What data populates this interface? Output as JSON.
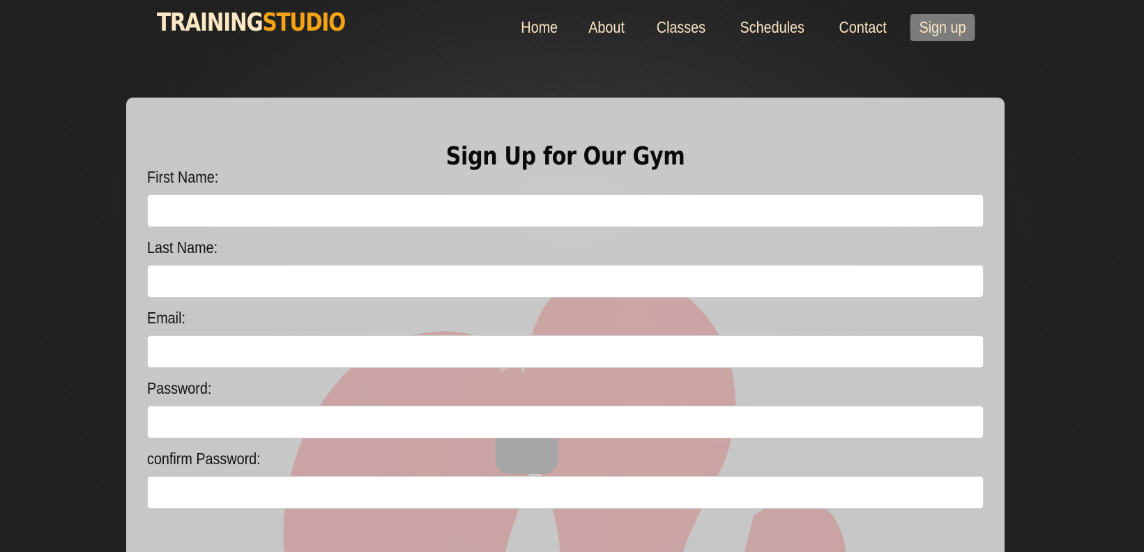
{
  "brand": {
    "primary": "TRAINING",
    "accent": "STUDIO",
    "primary_color": "#fbe7c4",
    "accent_color": "#f5a215"
  },
  "nav": {
    "items": [
      {
        "label": "Home",
        "active": false
      },
      {
        "label": "About",
        "active": false
      },
      {
        "label": "Classes",
        "active": false
      },
      {
        "label": "Schedules",
        "active": false
      },
      {
        "label": "Contact",
        "active": false
      },
      {
        "label": "Sign up",
        "active": true
      }
    ]
  },
  "form": {
    "title": "Sign Up for Our Gym",
    "fields": [
      {
        "label": "First Name:",
        "value": "",
        "placeholder": ""
      },
      {
        "label": "Last Name:",
        "value": "",
        "placeholder": ""
      },
      {
        "label": "Email:",
        "value": "",
        "placeholder": ""
      },
      {
        "label": "Password:",
        "value": "",
        "placeholder": ""
      },
      {
        "label": "confirm Password:",
        "value": "",
        "placeholder": ""
      }
    ]
  }
}
